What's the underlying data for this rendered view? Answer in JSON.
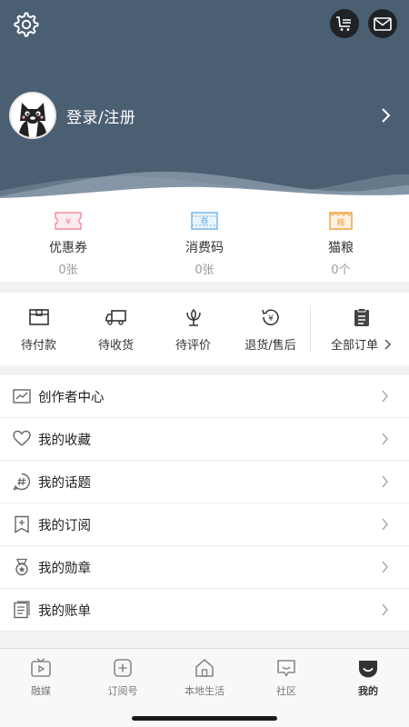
{
  "header": {
    "login_text": "登录/注册"
  },
  "assets": [
    {
      "label": "优惠券",
      "value": "0张",
      "icon": "coupon-icon",
      "icon_text": "¥",
      "color": "#f08c9b"
    },
    {
      "label": "消费码",
      "value": "0张",
      "icon": "voucher-icon",
      "icon_text": "券",
      "color": "#6fb3e8"
    },
    {
      "label": "猫粮",
      "value": "0个",
      "icon": "cat-food-icon",
      "icon_text": "粮",
      "color": "#f0a040"
    }
  ],
  "orders": [
    {
      "label": "待付款",
      "icon": "wallet-icon"
    },
    {
      "label": "待收货",
      "icon": "truck-icon"
    },
    {
      "label": "待评价",
      "icon": "flower-icon"
    },
    {
      "label": "退货/售后",
      "icon": "refund-icon"
    },
    {
      "label": "全部订单",
      "icon": "clipboard-icon"
    }
  ],
  "menu": [
    {
      "label": "创作者中心",
      "icon": "chart-icon"
    },
    {
      "label": "我的收藏",
      "icon": "heart-icon"
    },
    {
      "label": "我的话题",
      "icon": "hashtag-icon"
    },
    {
      "label": "我的订阅",
      "icon": "bookmark-plus-icon"
    },
    {
      "label": "我的勋章",
      "icon": "medal-icon"
    },
    {
      "label": "我的账单",
      "icon": "bill-icon"
    }
  ],
  "tabs": [
    {
      "label": "融媒",
      "icon": "tv-icon",
      "active": false
    },
    {
      "label": "订阅号",
      "icon": "plus-square-icon",
      "active": false
    },
    {
      "label": "本地生活",
      "icon": "house-icon",
      "active": false
    },
    {
      "label": "社区",
      "icon": "chat-icon",
      "active": false
    },
    {
      "label": "我的",
      "icon": "smile-icon",
      "active": true
    }
  ],
  "colors": {
    "header_bg": "#4b5f73",
    "accent_dark": "#1f2328"
  }
}
